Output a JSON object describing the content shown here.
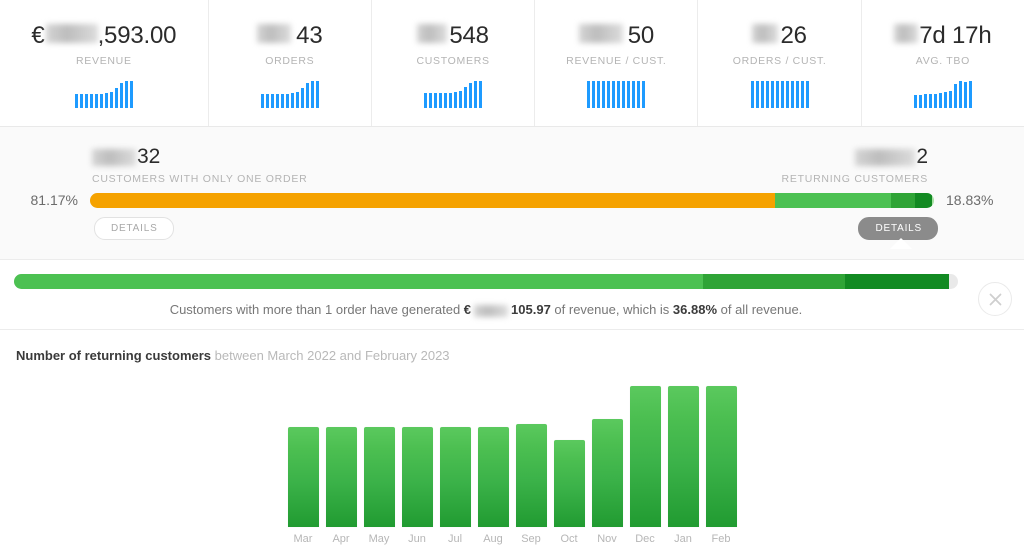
{
  "kpis": [
    {
      "name": "revenue",
      "currency": "€",
      "redacted_width": 52,
      "value": ",593.00",
      "label": "REVENUE",
      "spark": [
        52,
        52,
        52,
        52,
        52,
        52,
        55,
        58,
        75,
        92,
        100,
        100
      ]
    },
    {
      "name": "orders",
      "redacted_width": 34,
      "value": "43",
      "label": "ORDERS",
      "spark": [
        52,
        52,
        52,
        52,
        52,
        52,
        55,
        58,
        75,
        92,
        100,
        100
      ]
    },
    {
      "name": "customers",
      "redacted_width": 30,
      "value": "548",
      "label": "CUSTOMERS",
      "spark": [
        55,
        55,
        55,
        55,
        55,
        55,
        58,
        62,
        78,
        92,
        100,
        100
      ]
    },
    {
      "name": "revenue-per-customer",
      "redacted_width": 44,
      "value": "50",
      "label": "REVENUE / CUST.",
      "spark": [
        100,
        100,
        100,
        100,
        100,
        100,
        100,
        100,
        100,
        100,
        100,
        100
      ]
    },
    {
      "name": "orders-per-customer",
      "redacted_width": 26,
      "value": "26",
      "label": "ORDERS / CUST.",
      "spark": [
        100,
        100,
        100,
        100,
        100,
        100,
        100,
        100,
        100,
        100,
        100,
        100
      ]
    },
    {
      "name": "avg-tbo",
      "redacted_width": 24,
      "value": "7d 17h",
      "label": "AVG. TBO",
      "spark": [
        48,
        48,
        50,
        50,
        52,
        55,
        58,
        62,
        88,
        100,
        96,
        100
      ]
    }
  ],
  "split": {
    "left": {
      "redacted_width": 44,
      "value": "32",
      "label": "CUSTOMERS WITH ONLY ONE ORDER",
      "percent": "81.17%",
      "percent_num": 81.17,
      "details_label": "DETAILS"
    },
    "right": {
      "redacted_width": 60,
      "value": "2",
      "label": "RETURNING CUSTOMERS",
      "percent": "18.83%",
      "percent_num": 18.83,
      "details_label": "DETAILS"
    },
    "colors": {
      "orange": "#f5a200",
      "green_light": "#4cc152",
      "green_mid": "#2fa436",
      "green_dark": "#128a22",
      "track": "#e4e4e4"
    }
  },
  "callout": {
    "bar_segments": [
      73,
      15,
      11
    ],
    "text_parts": {
      "p1": "Customers with more than 1 order have generated ",
      "currency": "€",
      "redacted_width": 34,
      "amount": "105.97",
      "p2": " of revenue, which is ",
      "share": "36.88%",
      "p3": " of all revenue."
    },
    "close_icon": "close-icon"
  },
  "chart_data": {
    "type": "bar",
    "title": "Number of returning customers",
    "subtitle": "between March 2022 and February 2023",
    "categories": [
      "Mar",
      "Apr",
      "May",
      "Jun",
      "Jul",
      "Aug",
      "Sep",
      "Oct",
      "Nov",
      "Dec",
      "Jan",
      "Feb"
    ],
    "values": [
      100,
      100,
      100,
      100,
      100,
      100,
      103,
      87,
      108,
      141,
      141,
      141
    ],
    "ylabel": "",
    "xlabel": "",
    "ylim": [
      0,
      150
    ],
    "grid": false,
    "legend": null,
    "bar_color_top": "#5bc95e",
    "bar_color_bottom": "#219b31"
  }
}
